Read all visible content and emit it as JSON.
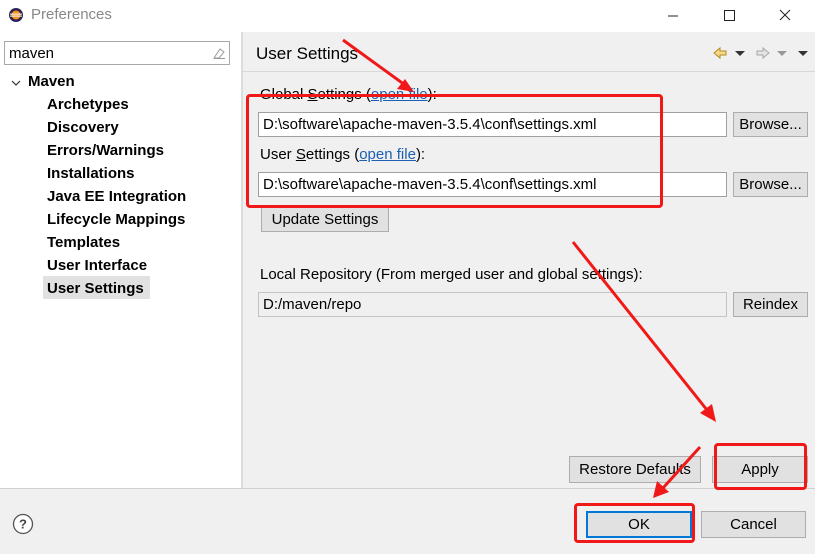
{
  "window": {
    "title": "Preferences",
    "app_icon": "eclipse-icon",
    "controls": [
      "minimize-icon",
      "maximize-icon",
      "close-icon"
    ]
  },
  "sidebar": {
    "filter_value": "maven",
    "filter_clear_icon": "clear-filter-icon",
    "root": {
      "label": "Maven",
      "expanded": true
    },
    "items": [
      {
        "label": "Archetypes"
      },
      {
        "label": "Discovery"
      },
      {
        "label": "Errors/Warnings"
      },
      {
        "label": "Installations"
      },
      {
        "label": "Java EE Integration"
      },
      {
        "label": "Lifecycle Mappings"
      },
      {
        "label": "Templates"
      },
      {
        "label": "User Interface"
      },
      {
        "label": "User Settings",
        "selected": true
      }
    ]
  },
  "page": {
    "title": "User Settings",
    "nav_icons": [
      "back-arrow-icon",
      "dropdown-icon",
      "forward-arrow-icon",
      "dropdown-icon",
      "view-menu-icon"
    ],
    "global_settings": {
      "label_prefix": "Global ",
      "label_mnemonic": "S",
      "label_suffix": "ettings (",
      "link": "open file",
      "label_end": "):",
      "value": "D:\\software\\apache-maven-3.5.4\\conf\\settings.xml",
      "browse_label": "Browse..."
    },
    "user_settings": {
      "label_prefix": "User ",
      "label_mnemonic": "S",
      "label_suffix": "ettings (",
      "link": "open file",
      "label_end": "):",
      "value": "D:\\software\\apache-maven-3.5.4\\conf\\settings.xml",
      "browse_label": "Browse..."
    },
    "update_settings_label": "Update Settings",
    "local_repo": {
      "label": "Local Repository (From merged user and global settings):",
      "value": "D:/maven/repo",
      "reindex_label": "Reindex"
    },
    "restore_defaults_label": "Restore Defaults",
    "apply_label": "Apply"
  },
  "footer": {
    "help_icon": "help-icon",
    "ok_label": "OK",
    "cancel_label": "Cancel"
  },
  "annotation_color": "#f01818"
}
